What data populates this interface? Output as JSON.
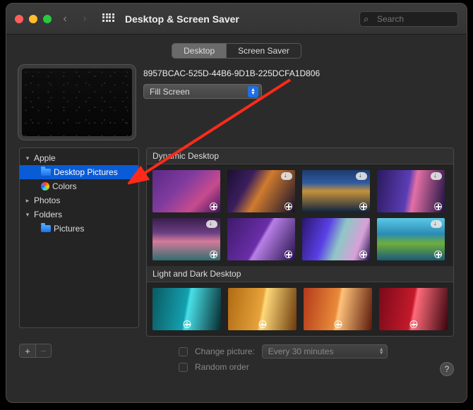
{
  "window": {
    "title": "Desktop & Screen Saver",
    "search_placeholder": "Search"
  },
  "tabs": {
    "desktop": "Desktop",
    "screensaver": "Screen Saver",
    "active": "desktop"
  },
  "preview": {
    "filename": "8957BCAC-525D-44B6-9D1B-225DCFA1D806",
    "fit_mode": "Fill Screen"
  },
  "sidebar": {
    "apple": {
      "label": "Apple",
      "expanded": true
    },
    "desktop_pictures": {
      "label": "Desktop Pictures",
      "selected": true
    },
    "colors": {
      "label": "Colors"
    },
    "photos": {
      "label": "Photos",
      "expanded": false
    },
    "folders": {
      "label": "Folders",
      "expanded": true
    },
    "pictures": {
      "label": "Pictures"
    }
  },
  "gallery": {
    "section1": "Dynamic Desktop",
    "section2": "Light and Dark Desktop"
  },
  "footer": {
    "change_picture_label": "Change picture:",
    "interval": "Every 30 minutes",
    "random_label": "Random order",
    "plus": "+",
    "minus": "−",
    "help": "?"
  }
}
